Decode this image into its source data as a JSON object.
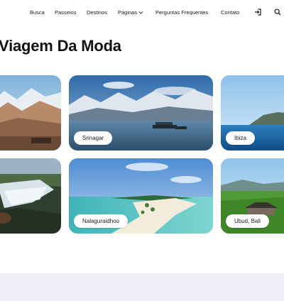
{
  "nav": {
    "items": [
      "Busca",
      "Passeios",
      "Destinos",
      "Páginas",
      "Perguntas Frequentes",
      "Contato"
    ]
  },
  "icons": {
    "login": "login-icon",
    "search": "search-icon",
    "dropdown": "chevron-down-icon"
  },
  "section": {
    "title": "Viagem Da Moda"
  },
  "destinations": [
    {
      "name": ""
    },
    {
      "name": "Srinagar"
    },
    {
      "name": "Ibiza"
    },
    {
      "name": ""
    },
    {
      "name": "Nalaguraidhoo"
    },
    {
      "name": "Ubud, Bali"
    }
  ],
  "colors": {
    "background": "#ffffff",
    "footer_band": "#eeedf8",
    "text": "#1a1a1a"
  }
}
